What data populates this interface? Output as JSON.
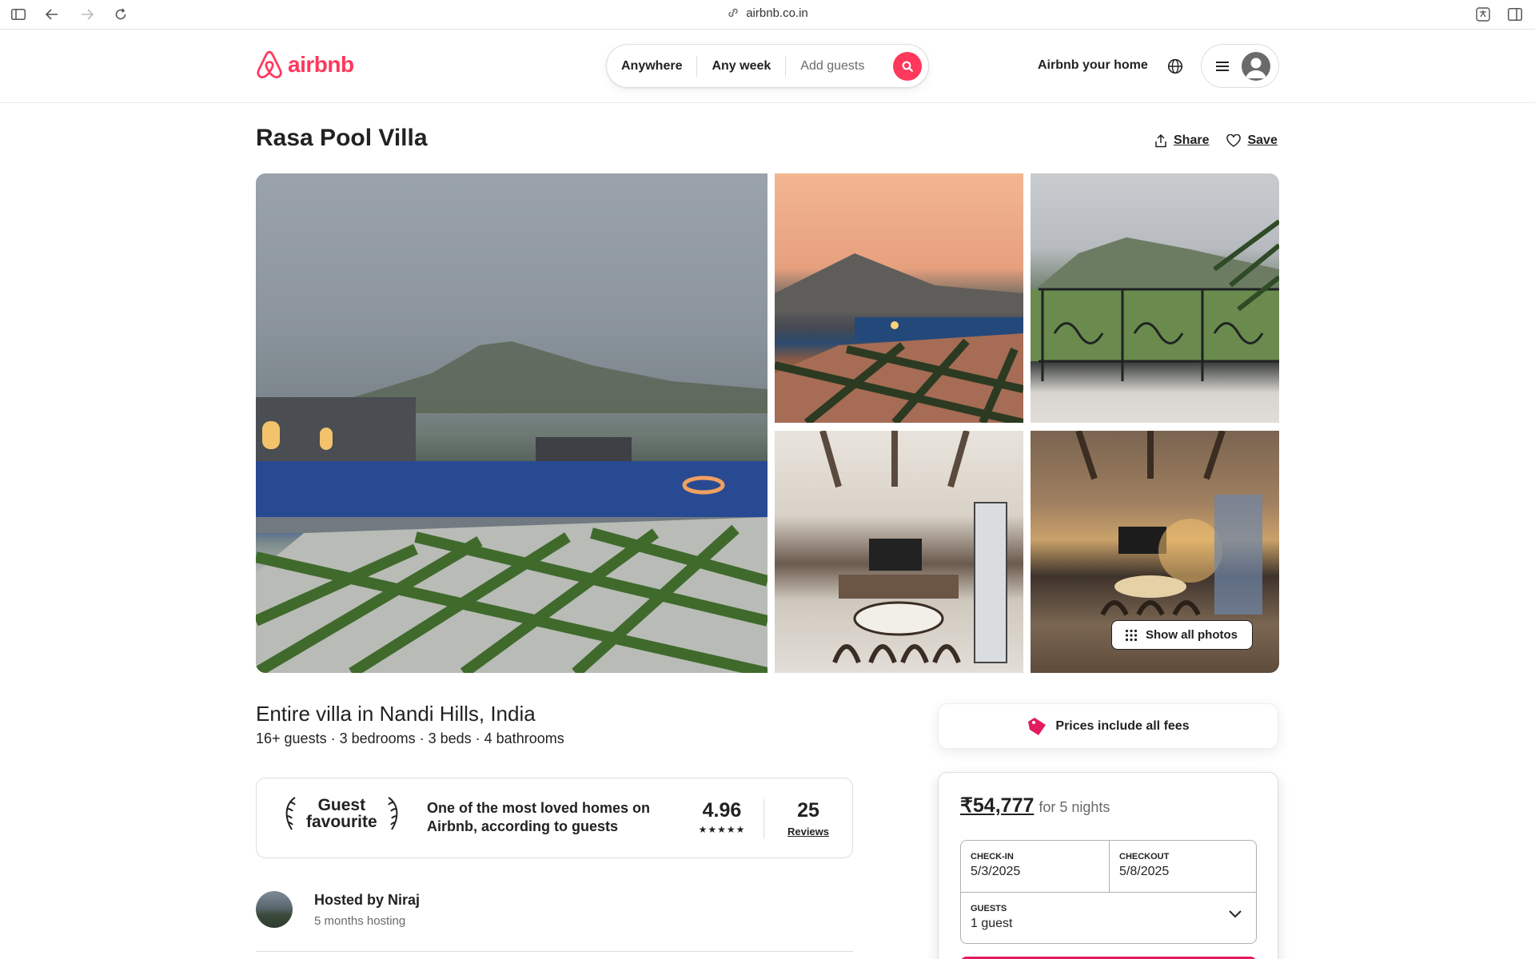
{
  "browser": {
    "url": "airbnb.co.in",
    "icons": [
      "sidebar-icon",
      "back-icon",
      "forward-icon",
      "reload-icon",
      "link-icon",
      "translate-icon",
      "split-view-icon"
    ]
  },
  "header": {
    "brand": "airbnb",
    "search": {
      "where": "Anywhere",
      "when": "Any week",
      "guests_placeholder": "Add guests"
    },
    "host_link": "Airbnb your home",
    "colors": {
      "brand": "#ff385c"
    }
  },
  "listing": {
    "title": "Rasa Pool Villa",
    "share_label": "Share",
    "save_label": "Save",
    "show_all_photos": "Show all photos",
    "place_type": "Entire villa in Nandi Hills, India",
    "meta": "16+ guests · 3 bedrooms · 3 beds · 4 bathrooms"
  },
  "guest_favourite": {
    "title_line1": "Guest",
    "title_line2": "favourite",
    "description": "One of the most loved homes on Airbnb, according to guests",
    "rating": "4.96",
    "stars": "★★★★★",
    "reviews_count": "25",
    "reviews_label": "Reviews"
  },
  "host": {
    "name": "Hosted by Niraj",
    "since": "5 months hosting"
  },
  "booking": {
    "fees_note": "Prices include all fees",
    "price": "₹54,777",
    "price_period": "for 5 nights",
    "checkin_label": "CHECK-IN",
    "checkin_value": "5/3/2025",
    "checkout_label": "CHECKOUT",
    "checkout_value": "5/8/2025",
    "guests_label": "GUESTS",
    "guests_value": "1 guest"
  }
}
